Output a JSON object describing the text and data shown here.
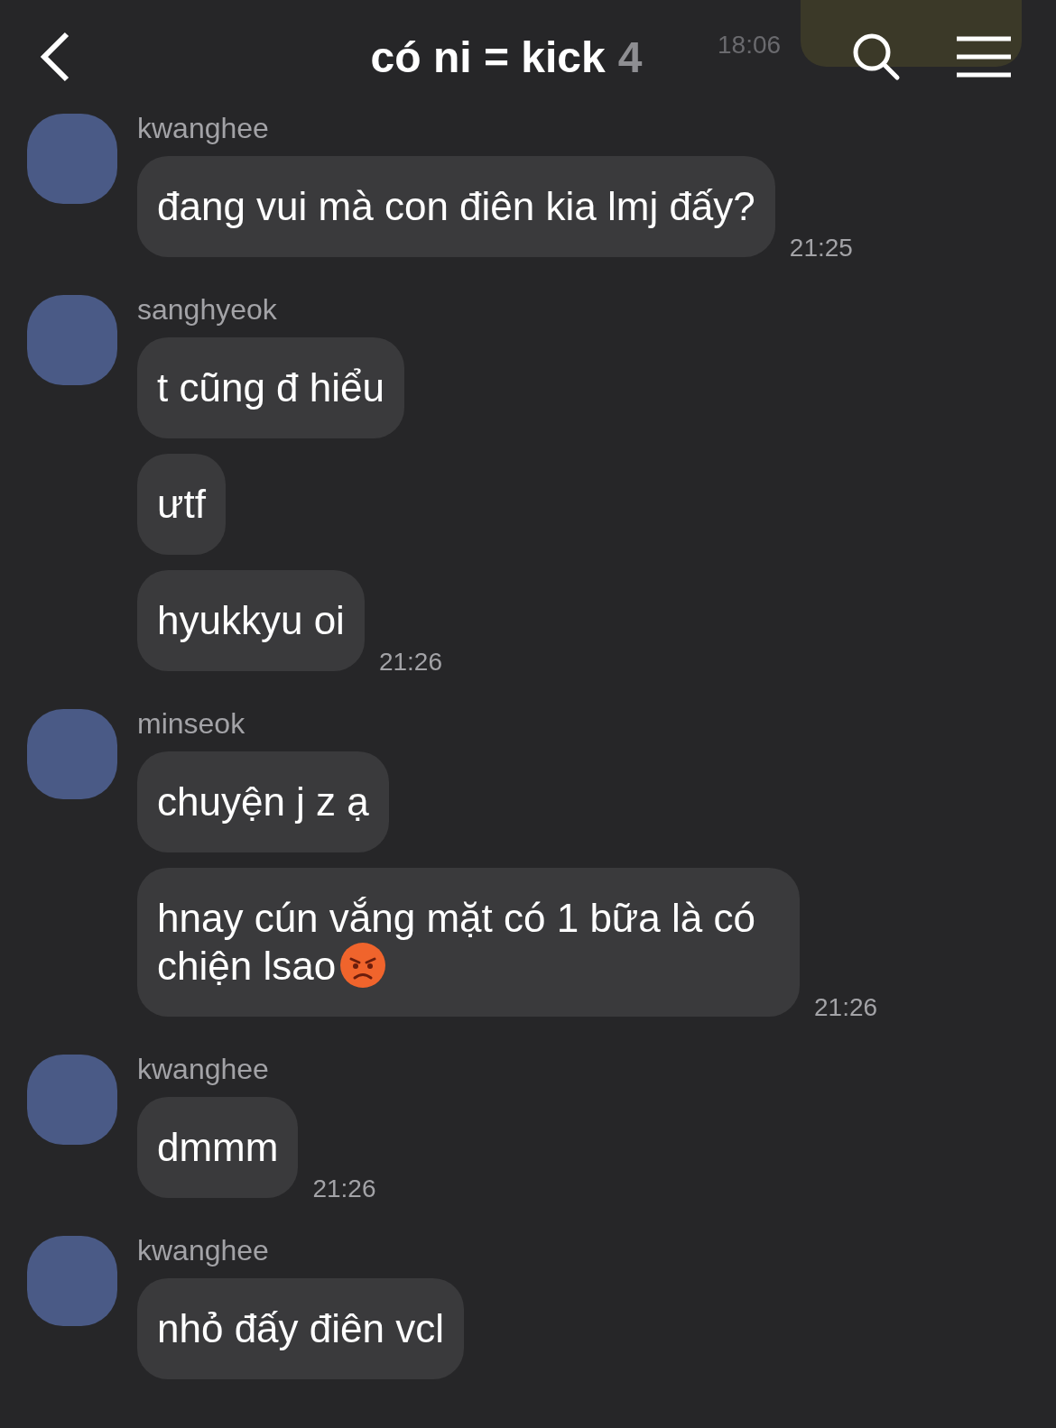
{
  "header": {
    "title": "có ni = kick",
    "member_count": "4",
    "behind_time": "18:06"
  },
  "groups": [
    {
      "sender": "kwanghee",
      "messages": [
        {
          "text": "đang vui mà con điên kia lmj đấy?",
          "time": "21:25"
        }
      ]
    },
    {
      "sender": "sanghyeok",
      "messages": [
        {
          "text": "t cũng đ hiểu"
        },
        {
          "text": "ưtf"
        },
        {
          "text": "hyukkyu oi",
          "time": "21:26"
        }
      ]
    },
    {
      "sender": "minseok",
      "messages": [
        {
          "text": "chuyện j z ạ"
        },
        {
          "text": "hnay cún vắng mặt có 1 bữa là có chiện lsao",
          "emoji_after": true,
          "time": "21:26"
        }
      ]
    },
    {
      "sender": "kwanghee",
      "messages": [
        {
          "text": "dmmm",
          "time": "21:26"
        }
      ]
    },
    {
      "sender": "kwanghee",
      "messages": [
        {
          "text": "nhỏ đấy điên vcl"
        }
      ]
    }
  ]
}
